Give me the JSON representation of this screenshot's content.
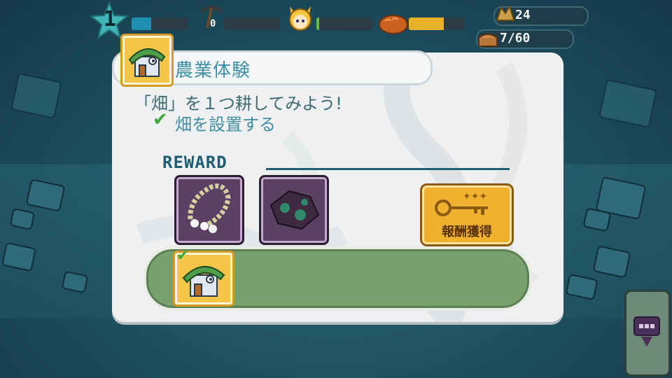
{
  "hud": {
    "level": "1",
    "pickaxe_count": "0",
    "gold_count": "24",
    "storage": "7/60",
    "xp_progress": 0.35,
    "stamina_progress": 0.0,
    "mood_progress": 0.05,
    "food_progress": 0.62,
    "colors": {
      "xp": "#1e8fb0",
      "mood": "#5fc23b",
      "food": "#e8b12a"
    }
  },
  "quest": {
    "title": "農業体験",
    "description": "「畑」を１つ耕してみよう!",
    "task": "畑を設置する",
    "task_done": true,
    "reward_label": "REWARD",
    "rewards": [
      {
        "icon": "pearl-necklace-icon"
      },
      {
        "icon": "dark-gem-ore-icon"
      }
    ],
    "claim_button": "報酬獲得"
  },
  "icons": {
    "quest": "green-roof-house-icon",
    "pickaxe": "pickaxe-icon",
    "character": "fox-girl-face-icon",
    "food": "bread-icon",
    "gold": "gold-ore-icon",
    "chest": "treasure-chest-icon",
    "menu": "chat-bubble-menu-icon"
  }
}
